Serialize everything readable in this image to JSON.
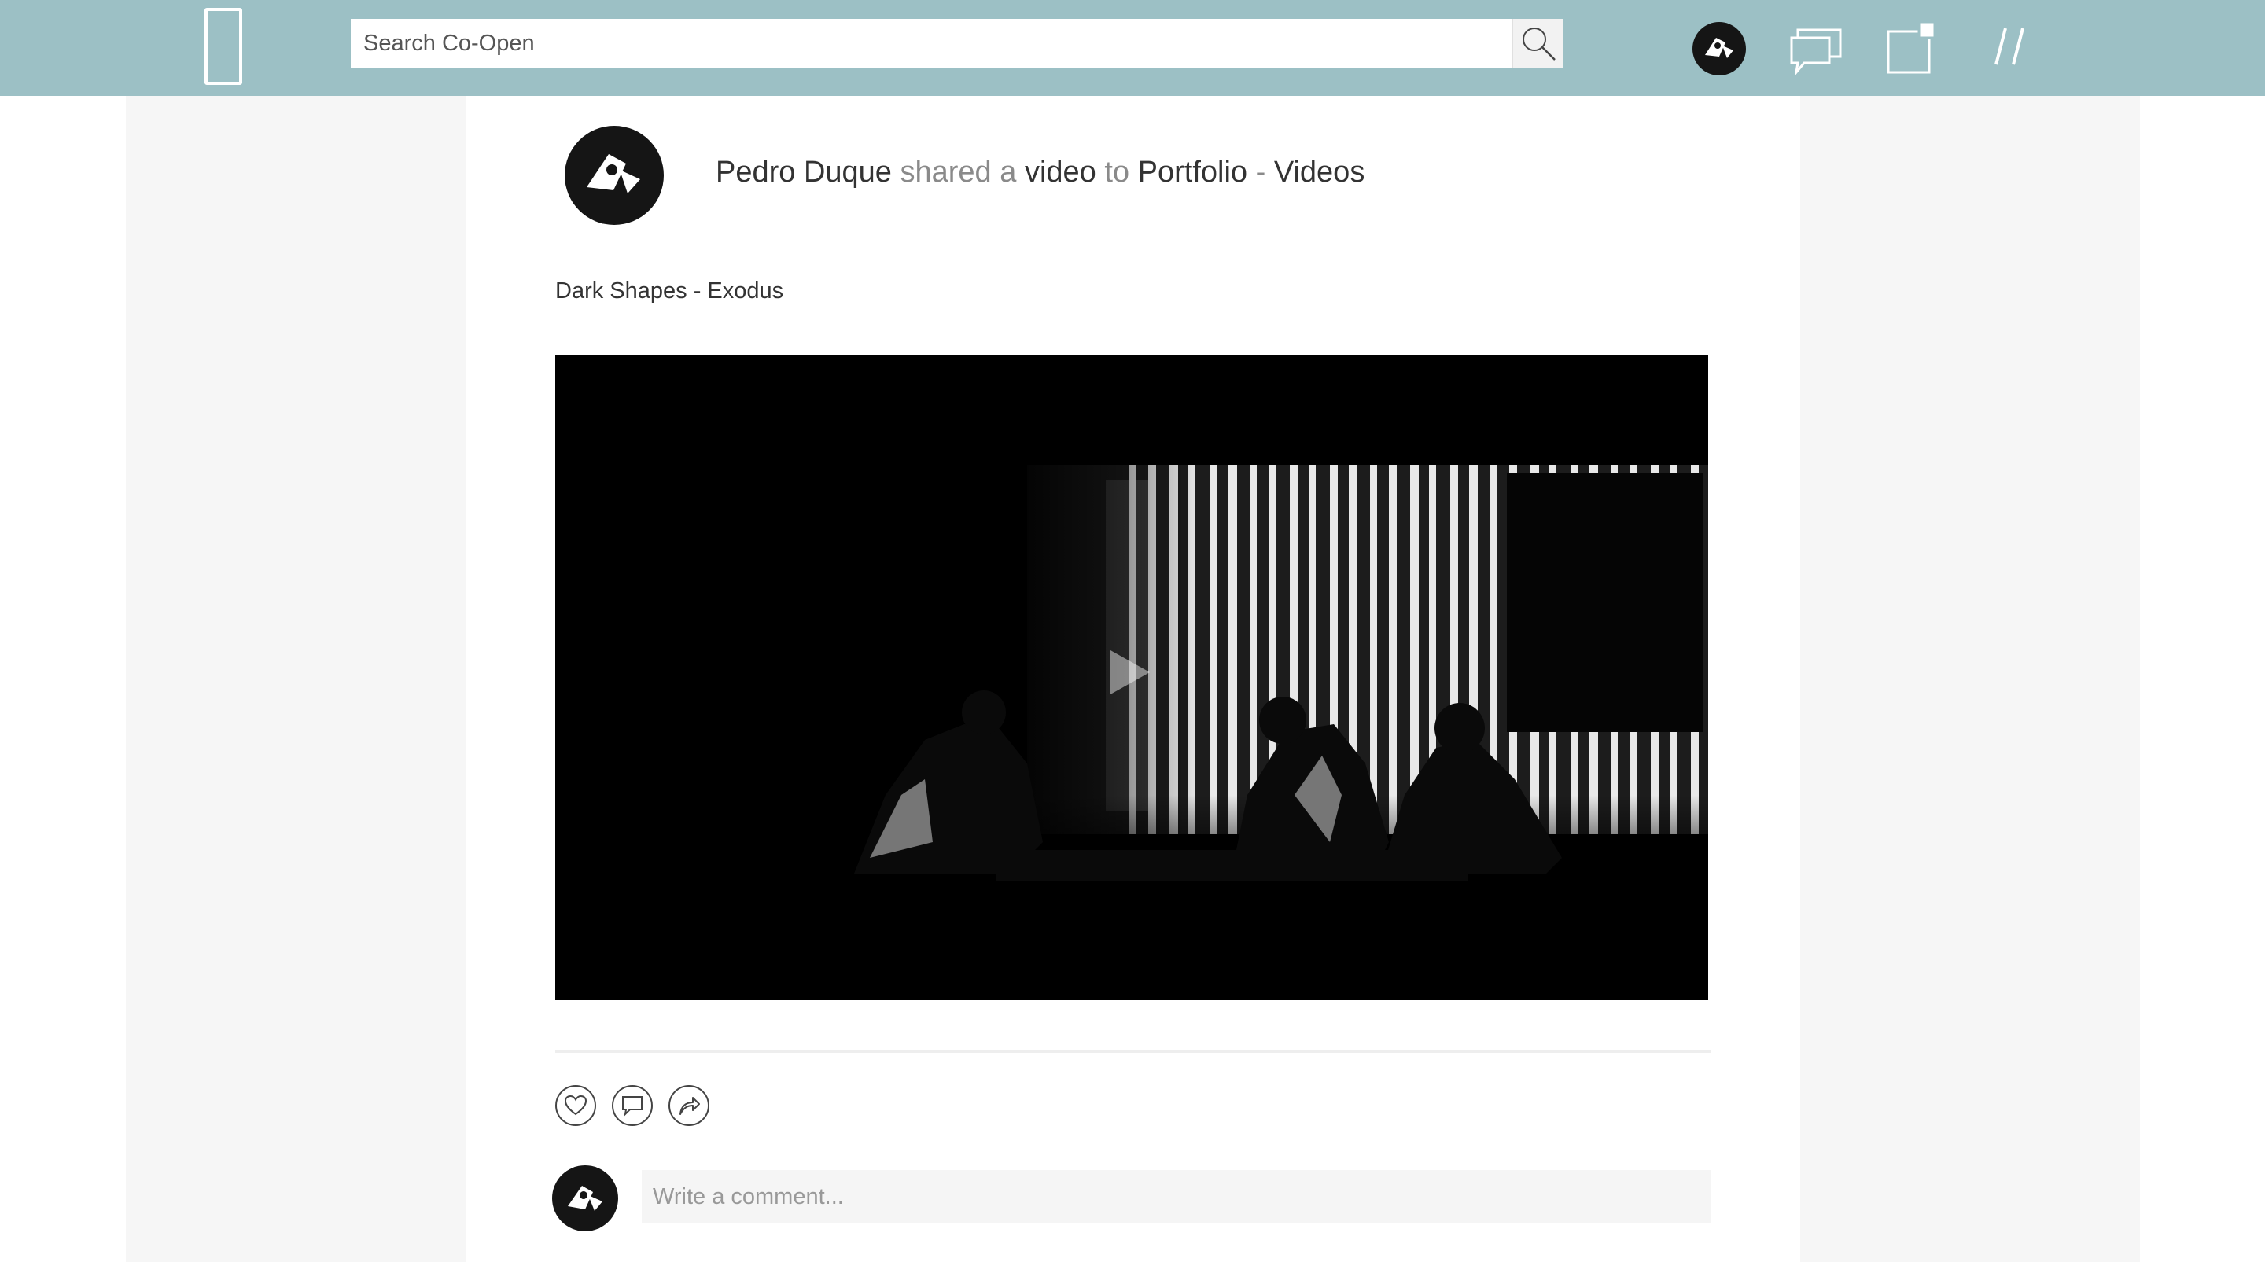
{
  "nav": {
    "search_placeholder": "Search Co-Open",
    "menu_glyph": "//",
    "icons": [
      "logo-icon",
      "search-icon",
      "user-avatar",
      "messages-icon",
      "new-post-icon",
      "menu-icon"
    ],
    "bar_color": "#9cc0c5"
  },
  "post": {
    "author": "Pedro Duque",
    "verb": "shared a",
    "object": "video",
    "preposition": "to",
    "destination": "Portfolio",
    "separator": "-",
    "collection": "Videos",
    "title": "Dark Shapes - Exodus",
    "video": {
      "thumbnail": "Black-and-white concert photo: performers crouched over equipment in front of a striped light projection",
      "play_icon": "play-icon"
    }
  },
  "actions": {
    "icons": [
      "heart-icon",
      "comment-icon",
      "share-icon"
    ]
  },
  "comment": {
    "placeholder": "Write a comment..."
  }
}
